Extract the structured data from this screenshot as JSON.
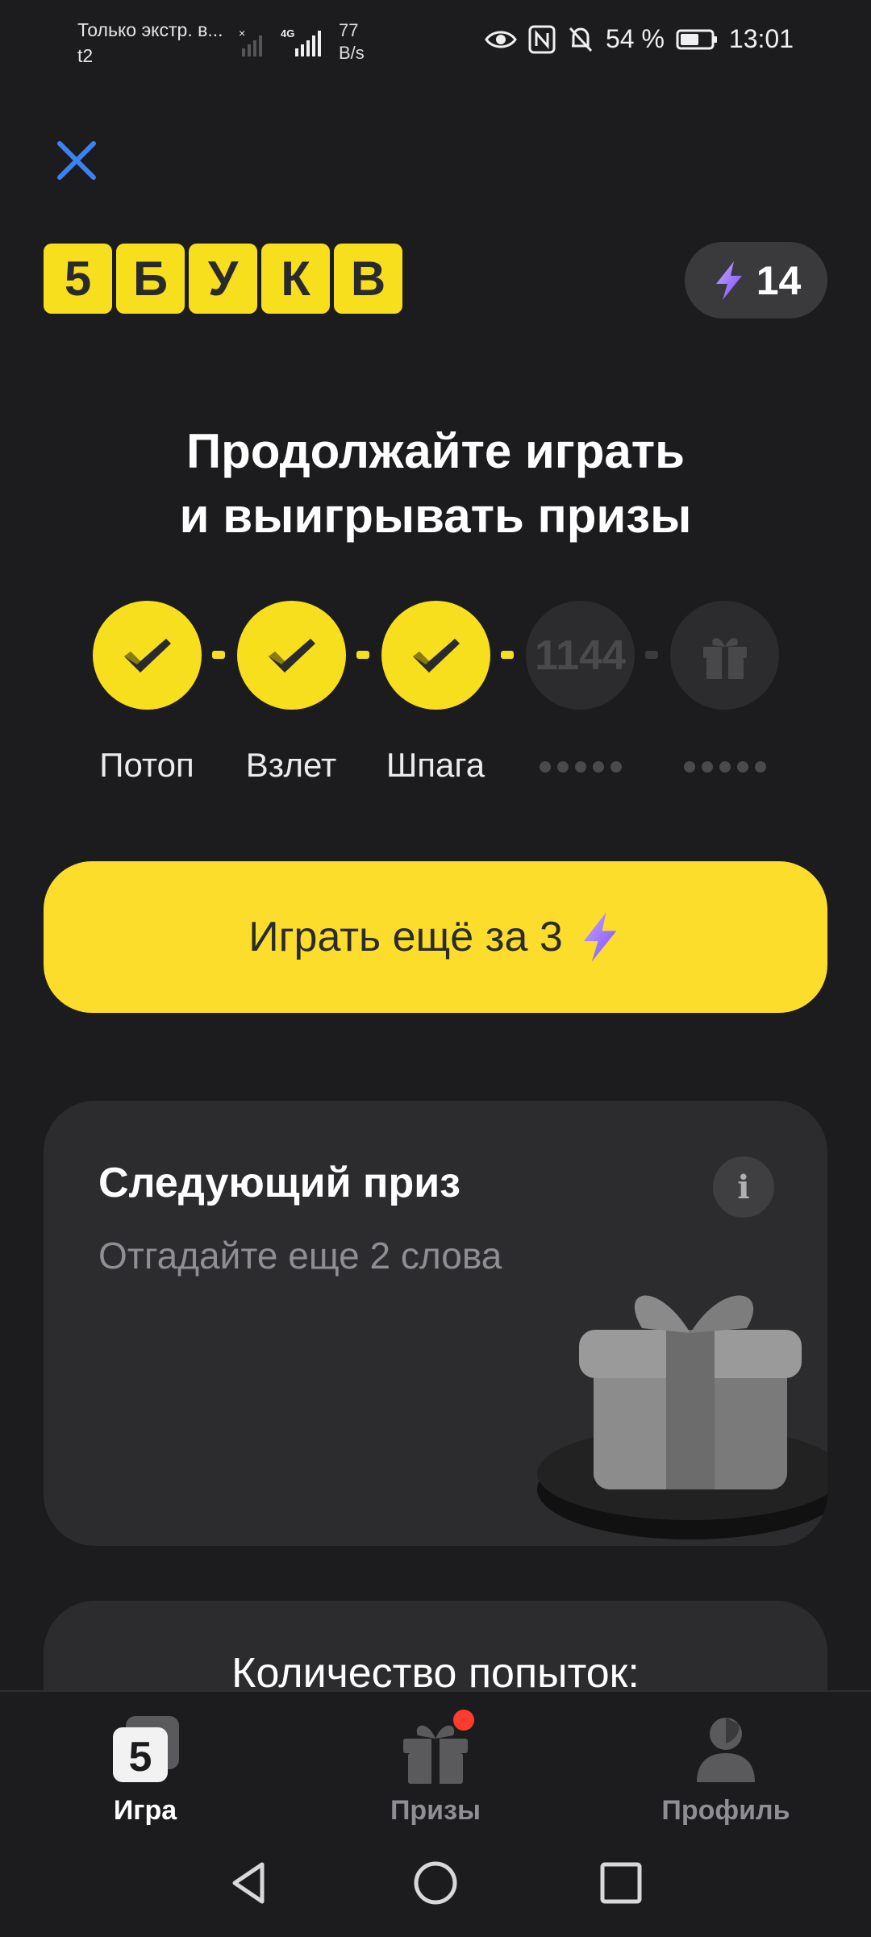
{
  "status_bar": {
    "carrier_text": "Только экстр. в...",
    "operator": "t2",
    "network": "4G",
    "speed_value": "77",
    "speed_unit": "B/s",
    "battery_percent": "54 %",
    "time": "13:01"
  },
  "header": {
    "close_icon": "close-icon",
    "logo_letters": [
      "5",
      "Б",
      "У",
      "К",
      "В"
    ],
    "energy_count": "14"
  },
  "headline": {
    "line1": "Продолжайте играть",
    "line2": "и выигрывать призы"
  },
  "progress": {
    "steps": [
      {
        "label": "Потоп",
        "state": "done"
      },
      {
        "label": "Взлет",
        "state": "done"
      },
      {
        "label": "Шпага",
        "state": "done"
      },
      {
        "number": "1144",
        "state": "locked"
      },
      {
        "icon": "gift-icon",
        "state": "locked"
      }
    ]
  },
  "play_button": {
    "label": "Играть ещё за 3"
  },
  "next_prize": {
    "title": "Следующий приз",
    "subtitle": "Отгадайте еще 2 слова",
    "info_symbol": "i"
  },
  "attempts": {
    "label": "Количество попыток:"
  },
  "bottom_nav": {
    "items": [
      {
        "label": "Игра",
        "icon": "game-icon",
        "active": true
      },
      {
        "label": "Призы",
        "icon": "prizes-icon",
        "active": false
      },
      {
        "label": "Профиль",
        "icon": "profile-icon",
        "active": false
      }
    ]
  },
  "colors": {
    "accent_yellow": "#fddd2c",
    "background": "#1c1c1e",
    "card": "#2c2c2e",
    "close_blue": "#3b82f6",
    "badge_red": "#ff3b30"
  }
}
